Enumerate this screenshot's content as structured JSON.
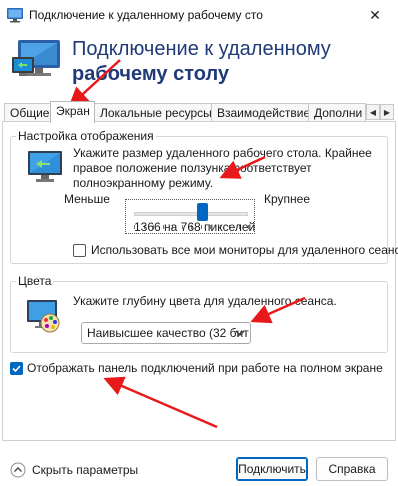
{
  "window": {
    "title": "Подключение к удаленному рабочему сто",
    "close_glyph": "✕"
  },
  "header": {
    "title_line1": "Подключение к удаленному",
    "title_line2": "рабочему столу"
  },
  "tabs": [
    {
      "label": "Общие",
      "active": false
    },
    {
      "label": "Экран",
      "active": true
    },
    {
      "label": "Локальные ресурсы",
      "active": false
    },
    {
      "label": "Взаимодействие",
      "active": false
    },
    {
      "label": "Дополни",
      "active": false
    }
  ],
  "tab_scroll": {
    "left": "◀",
    "right": "▶"
  },
  "display_settings": {
    "group_title": "Настройка отображения",
    "description": "Укажите размер удаленного рабочего стола. Крайнее правое положение ползунка соответствует полноэкранному режиму.",
    "slider_min_label": "Меньше",
    "slider_max_label": "Крупнее",
    "slider_position": 0.6,
    "resolution_text": "1366 на 768 пикселей",
    "all_monitors_label": "Использовать все мои мониторы для удаленного сеанса",
    "all_monitors_checked": false
  },
  "colors": {
    "group_title": "Цвета",
    "description": "Укажите глубину цвета для удаленного сеанса.",
    "selected_option": "Наивысшее качество (32 бит"
  },
  "connection_bar": {
    "label": "Отображать панель подключений при работе на полном экране",
    "checked": true
  },
  "footer": {
    "options_label": "Скрыть параметры",
    "connect_button": "Подключить",
    "help_button": "Справка"
  },
  "accent_color": "#0067c0",
  "annotation_arrow_color": "#e8191b"
}
